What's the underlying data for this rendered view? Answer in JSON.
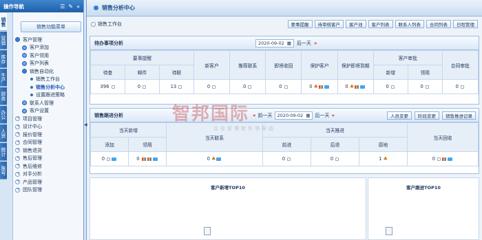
{
  "nav": {
    "title": "操作导航",
    "vtabs": [
      "销售",
      "营销",
      "库存",
      "生产",
      "财务",
      "办公",
      "人资",
      "统计",
      "账号"
    ],
    "menu_header": "销售功能菜单",
    "items": [
      {
        "label": "客户管理",
        "icon": "open"
      },
      {
        "label": "客户添加",
        "icon": "blue"
      },
      {
        "label": "客户领用",
        "icon": "blue"
      },
      {
        "label": "客户列表",
        "icon": "blue"
      },
      {
        "label": "销售自动化",
        "icon": "open"
      },
      {
        "label": "销售工作台",
        "icon": "dot"
      },
      {
        "label": "销售分析中心",
        "icon": "dot"
      },
      {
        "label": "设置跟进策略",
        "icon": "dot"
      },
      {
        "label": "联系人管理",
        "icon": "blue"
      },
      {
        "label": "客户设置",
        "icon": "blue"
      },
      {
        "label": "项目管理",
        "icon": "plus"
      },
      {
        "label": "设计中心",
        "icon": "plus"
      },
      {
        "label": "报价管理",
        "icon": "plus"
      },
      {
        "label": "合同管理",
        "icon": "plus"
      },
      {
        "label": "销售退货",
        "icon": "plus"
      },
      {
        "label": "售后管理",
        "icon": "plus"
      },
      {
        "label": "售后维修",
        "icon": "plus"
      },
      {
        "label": "对手分析",
        "icon": "plus"
      },
      {
        "label": "产品管理",
        "icon": "plus"
      },
      {
        "label": "团队管理",
        "icon": "plus"
      }
    ]
  },
  "page": {
    "title": "销售分析中心",
    "radio_label": "销售工作台",
    "buttons": [
      "要事提醒",
      "待审核客户",
      "客户池",
      "客户列表",
      "联系人列表",
      "合同列表",
      "日程管理"
    ]
  },
  "todo": {
    "title": "待办事项分析",
    "date": "2020-09-02",
    "next_label": "后一天",
    "group_reminder": "要事提醒",
    "cols": [
      "待查",
      "邮件",
      "待联"
    ],
    "new_customer": "新客户",
    "recommend": "推荐联系",
    "payment_due": "即将收回",
    "protect_customer": "保护客户",
    "protect_expiring": "保护即将到期",
    "group_review": "客户审批",
    "review_cols": [
      "新增",
      "领用"
    ],
    "contract_review": "合同审批",
    "values": {
      "pending": "396",
      "email": "0",
      "contact": "13",
      "review_new": "0",
      "review_take": "0",
      "protect_count": "0",
      "protect_exp_count": "0",
      "new_count": "0",
      "rec_count": "0",
      "pay_count": "0",
      "contract_count": "0"
    }
  },
  "followup": {
    "title": "销售跟进分析",
    "prev_label": "前一天",
    "date": "2020-09-02",
    "next_label": "后一天",
    "buttons": [
      "人员变更",
      "阶段变更",
      "销售推进记录"
    ],
    "group_new": "当天新增",
    "new_cols": [
      "添加",
      "领用"
    ],
    "contact": "当天联系",
    "group_push": "当天推进",
    "push_cols": [
      "前进",
      "后退",
      "原地"
    ],
    "payback": "当天回收",
    "values": {
      "add": "0",
      "take": "0",
      "contact": "0",
      "forward": "0",
      "back": "0",
      "stay": "1",
      "payback": "0"
    }
  },
  "charts": {
    "left_title": "客户新增TOP10",
    "right_title": "客户跟进TOP10"
  },
  "watermark": {
    "cn": "智邦国际",
    "sub": "企业管理软件领导品"
  }
}
